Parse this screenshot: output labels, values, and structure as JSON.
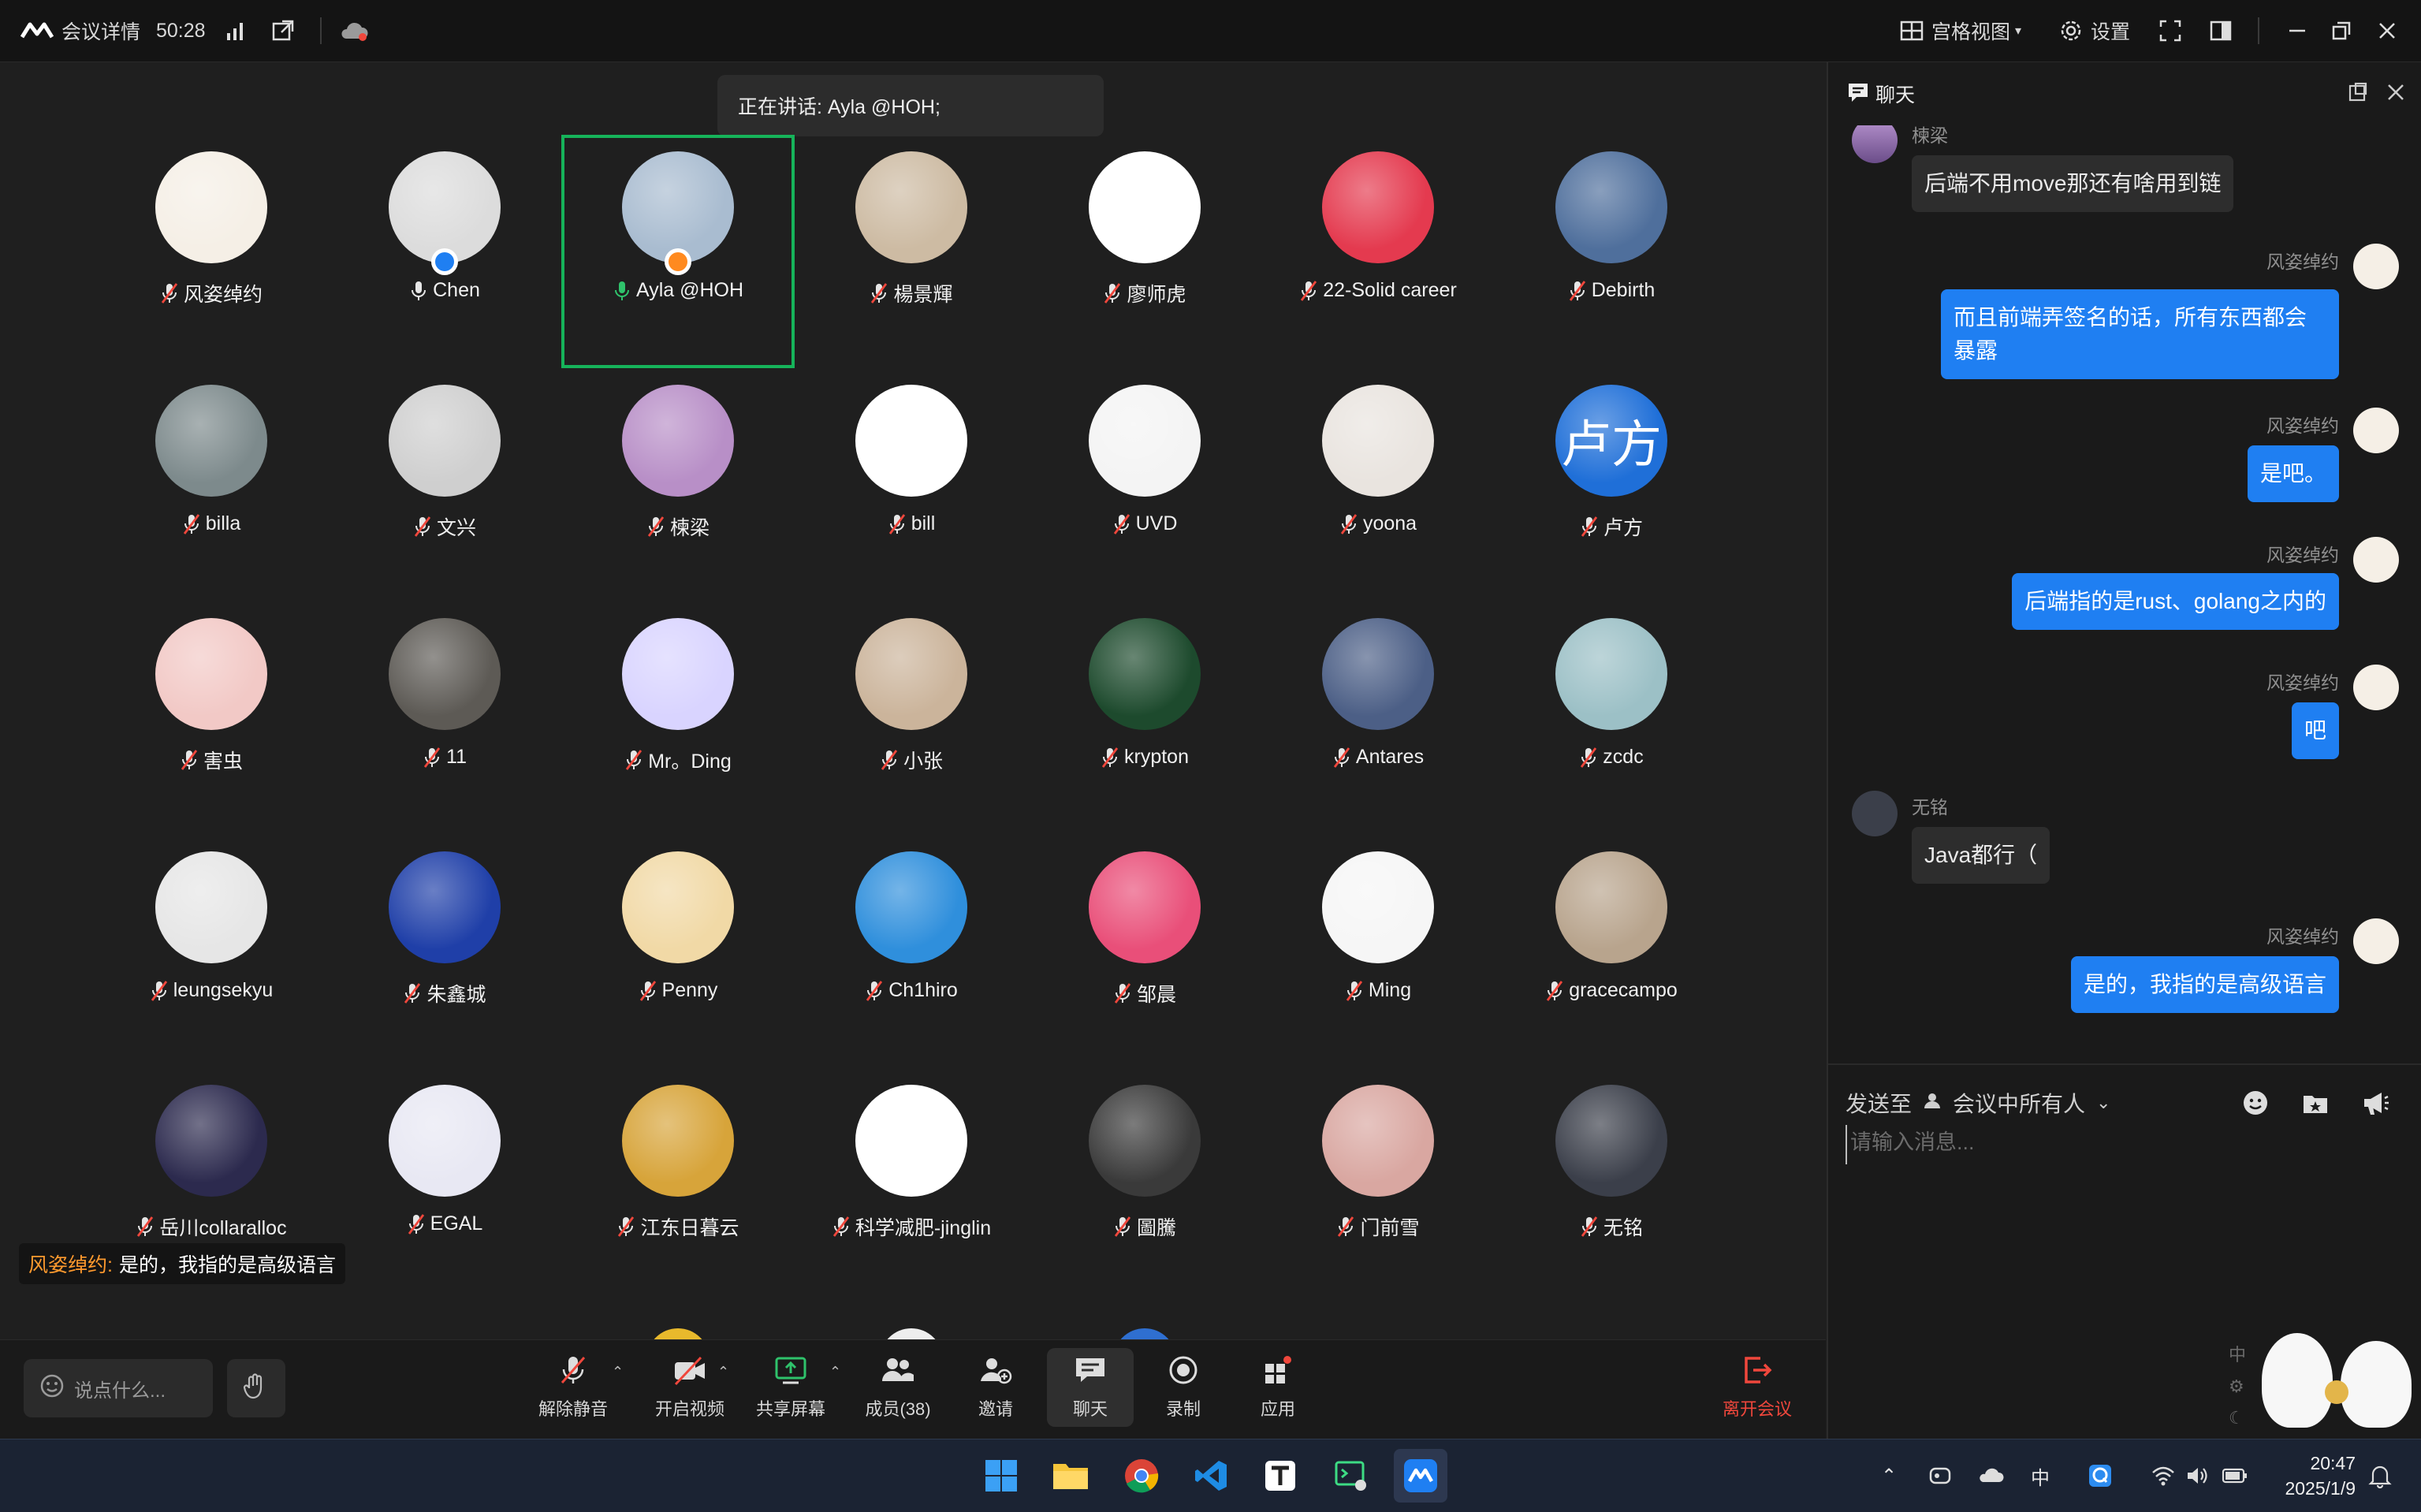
{
  "topbar": {
    "meeting_details": "会议详情",
    "timer": "50:28",
    "grid_view": "宫格视图",
    "settings": "设置"
  },
  "stage": {
    "speaking": "正在讲话: Ayla @HOH;",
    "caption_sender": "风姿绰约:",
    "caption_text": "是的，我指的是高级语言"
  },
  "participants": [
    {
      "name": "风姿绰约",
      "muted": true,
      "color": "#f5efe6"
    },
    {
      "name": "Chen",
      "muted": false,
      "color": "#dcdcdc",
      "badge": "#1f7ff2"
    },
    {
      "name": "Ayla @HOH",
      "muted": false,
      "color": "#a9bcd0",
      "badge": "#ff8a1f",
      "active": true
    },
    {
      "name": "楊景輝",
      "muted": true,
      "color": "#cdbba3"
    },
    {
      "name": "廖师虎",
      "muted": true,
      "color": "#ffffff"
    },
    {
      "name": "22-Solid career",
      "muted": true,
      "color": "#e43a4f"
    },
    {
      "name": "Debirth",
      "muted": true,
      "color": "#4f6f9c"
    },
    {
      "name": "billa",
      "muted": true,
      "color": "#7d8a8c"
    },
    {
      "name": "文兴",
      "muted": true,
      "color": "#cfcfcf"
    },
    {
      "name": "楝梁",
      "muted": true,
      "color": "#b88fc7"
    },
    {
      "name": "bill",
      "muted": true,
      "color": "#ffffff"
    },
    {
      "name": "UVD",
      "muted": true,
      "color": "#f4f4f4"
    },
    {
      "name": "yoona",
      "muted": true,
      "color": "#e9e4df"
    },
    {
      "name": "卢方",
      "muted": true,
      "color": "#1f6fd8",
      "initials": "卢方"
    },
    {
      "name": "害虫",
      "muted": true,
      "color": "#f2c9c6"
    },
    {
      "name": "11",
      "muted": true,
      "color": "#5d5a55"
    },
    {
      "name": "Mr。Ding",
      "muted": true,
      "color": "#d9d4ff"
    },
    {
      "name": "小张",
      "muted": true,
      "color": "#cbb49b"
    },
    {
      "name": "krypton",
      "muted": true,
      "color": "#1d4a2d"
    },
    {
      "name": "Antares",
      "muted": true,
      "color": "#4c5f86"
    },
    {
      "name": "zcdc",
      "muted": true,
      "color": "#9cc0c6"
    },
    {
      "name": "leungsekyu",
      "muted": true,
      "color": "#e6e6e6"
    },
    {
      "name": "朱鑫城",
      "muted": true,
      "color": "#1f3fa8"
    },
    {
      "name": "Penny",
      "muted": true,
      "color": "#f1d9a6"
    },
    {
      "name": "Ch1hiro",
      "muted": true,
      "color": "#2f8fdc"
    },
    {
      "name": "邹晨",
      "muted": true,
      "color": "#e94f79"
    },
    {
      "name": "Ming",
      "muted": true,
      "color": "#f6f6f6"
    },
    {
      "name": "gracecampo",
      "muted": true,
      "color": "#b8a48d"
    },
    {
      "name": "岳川collaralloc",
      "muted": true,
      "color": "#2c2a4e"
    },
    {
      "name": "EGAL",
      "muted": true,
      "color": "#e8e8f3"
    },
    {
      "name": "江东日暮云",
      "muted": true,
      "color": "#d7a43a"
    },
    {
      "name": "科学减肥-jinglin",
      "muted": true,
      "color": "#ffffff"
    },
    {
      "name": "圖騰",
      "muted": true,
      "color": "#3a3a3a"
    },
    {
      "name": "门前雪",
      "muted": true,
      "color": "#d9a7a1"
    },
    {
      "name": "无铭",
      "muted": true,
      "color": "#3b3f4a"
    }
  ],
  "toolbar": {
    "say_placeholder": "说点什么...",
    "unmute": "解除静音",
    "start_video": "开启视频",
    "share_screen": "共享屏幕",
    "members": "成员(38)",
    "invite": "邀请",
    "chat": "聊天",
    "record": "录制",
    "apps": "应用",
    "leave": "离开会议"
  },
  "chat": {
    "title": "聊天",
    "messages": [
      {
        "sender": "楝梁",
        "text": "后端不用move那还有啥用到链",
        "mine": false
      },
      {
        "sender": "风姿绰约",
        "text": "而且前端弄签名的话，所有东西都会暴露",
        "mine": true
      },
      {
        "sender": "风姿绰约",
        "text": "是吧。",
        "mine": true
      },
      {
        "sender": "风姿绰约",
        "text": "后端指的是rust、golang之内的",
        "mine": true
      },
      {
        "sender": "风姿绰约",
        "text": "吧",
        "mine": true
      },
      {
        "sender": "无铭",
        "text": "Java都行（",
        "mine": false
      },
      {
        "sender": "风姿绰约",
        "text": "是的，我指的是高级语言",
        "mine": true
      }
    ],
    "send_to_label": "发送至",
    "send_to_target": "会议中所有人",
    "input_placeholder": "请输入消息..."
  },
  "taskbar": {
    "ime": "中",
    "time": "20:47",
    "date": "2025/1/9"
  },
  "colors": {
    "accent": "#1f7ff2",
    "active_speaker": "#16b35a",
    "leave": "#f0473c",
    "caption_name": "#ff9a2e"
  }
}
